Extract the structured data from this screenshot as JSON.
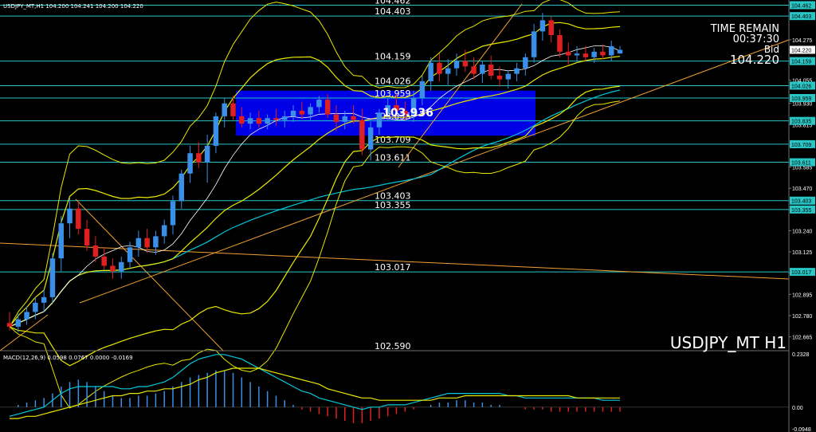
{
  "header": {
    "symbol_info": "USDJPY_MT,H1  104.200 104.241 104.200 104.220"
  },
  "time_remain": {
    "label": "TIME REMAIN",
    "value": "00:37:30",
    "bid_label": "Bid",
    "bid_value": "104.220"
  },
  "watermark": "USDJPY_MT H1",
  "macd": {
    "label": "MACD(12,26,9) 0.0598 0.0767 0.0000 -0.0169",
    "axis": [
      "0.2328",
      "0.00",
      "-0.0948"
    ]
  },
  "zone_label": "103.936",
  "colors": {
    "bull": "#3a8fe8",
    "bear": "#e02020",
    "band": "#e8e800",
    "ma_cyan": "#00c8d8",
    "level": "#29c6c6",
    "trend": "#f0a030",
    "zone": "#0000ff",
    "macd_signal": "#e8e800"
  },
  "chart_data": {
    "type": "candlestick",
    "y_axis_ticks": [
      "104.275",
      "104.159",
      "104.055",
      "103.930",
      "103.815",
      "103.700",
      "103.585",
      "103.470",
      "103.355",
      "103.240",
      "103.125",
      "103.010",
      "102.895",
      "102.780",
      "102.665"
    ],
    "ylim": [
      102.59,
      104.49
    ],
    "levels": [
      {
        "value": 104.462,
        "label": "104.462"
      },
      {
        "value": 104.403,
        "label": "104.403"
      },
      {
        "value": 104.159,
        "label": "104.159"
      },
      {
        "value": 104.026,
        "label": "104.026"
      },
      {
        "value": 103.959,
        "label": "103.959"
      },
      {
        "value": 103.835,
        "label": "103.835"
      },
      {
        "value": 103.709,
        "label": "103.709"
      },
      {
        "value": 103.611,
        "label": "103.611"
      },
      {
        "value": 103.403,
        "label": "103.403"
      },
      {
        "value": 103.355,
        "label": "103.355"
      },
      {
        "value": 103.017,
        "label": "103.017"
      },
      {
        "value": 102.59,
        "label": "102.590"
      }
    ],
    "axis_level_labels": [
      "104.462",
      "104.403",
      "104.220",
      "104.159",
      "104.026",
      "103.959",
      "103.835",
      "103.709",
      "103.611",
      "103.403",
      "103.355",
      "103.017"
    ],
    "zone": {
      "high": 103.959,
      "low": 103.835
    },
    "candles": [
      [
        102.74,
        102.8,
        102.7,
        102.72
      ],
      [
        102.72,
        102.79,
        102.69,
        102.76
      ],
      [
        102.76,
        102.83,
        102.73,
        102.8
      ],
      [
        102.8,
        102.88,
        102.76,
        102.85
      ],
      [
        102.85,
        102.92,
        102.8,
        102.88
      ],
      [
        102.88,
        103.12,
        102.85,
        103.09
      ],
      [
        103.09,
        103.32,
        103.02,
        103.28
      ],
      [
        103.28,
        103.42,
        103.2,
        103.36
      ],
      [
        103.36,
        103.4,
        103.22,
        103.25
      ],
      [
        103.25,
        103.3,
        103.13,
        103.16
      ],
      [
        103.16,
        103.21,
        103.07,
        103.1
      ],
      [
        103.1,
        103.15,
        103.03,
        103.05
      ],
      [
        103.05,
        103.09,
        102.98,
        103.02
      ],
      [
        103.02,
        103.1,
        102.98,
        103.07
      ],
      [
        103.07,
        103.18,
        103.04,
        103.15
      ],
      [
        103.15,
        103.24,
        103.1,
        103.2
      ],
      [
        103.2,
        103.25,
        103.12,
        103.15
      ],
      [
        103.15,
        103.24,
        103.11,
        103.21
      ],
      [
        103.21,
        103.3,
        103.17,
        103.27
      ],
      [
        103.27,
        103.43,
        103.22,
        103.4
      ],
      [
        103.4,
        103.57,
        103.36,
        103.55
      ],
      [
        103.55,
        103.7,
        103.5,
        103.66
      ],
      [
        103.66,
        103.72,
        103.58,
        103.61
      ],
      [
        103.61,
        103.76,
        103.5,
        103.7
      ],
      [
        103.7,
        103.88,
        103.66,
        103.86
      ],
      [
        103.86,
        103.96,
        103.8,
        103.93
      ],
      [
        103.93,
        103.97,
        103.84,
        103.86
      ],
      [
        103.86,
        103.91,
        103.8,
        103.82
      ],
      [
        103.82,
        103.88,
        103.79,
        103.85
      ],
      [
        103.85,
        103.89,
        103.8,
        103.82
      ],
      [
        103.82,
        103.87,
        103.79,
        103.85
      ],
      [
        103.85,
        103.9,
        103.81,
        103.84
      ],
      [
        103.84,
        103.89,
        103.8,
        103.86
      ],
      [
        103.86,
        103.92,
        103.83,
        103.89
      ],
      [
        103.89,
        103.94,
        103.85,
        103.87
      ],
      [
        103.87,
        103.93,
        103.84,
        103.91
      ],
      [
        103.91,
        103.97,
        103.88,
        103.95
      ],
      [
        103.95,
        103.98,
        103.85,
        103.87
      ],
      [
        103.87,
        103.92,
        103.78,
        103.83
      ],
      [
        103.83,
        103.89,
        103.79,
        103.86
      ],
      [
        103.86,
        103.92,
        103.82,
        103.84
      ],
      [
        103.84,
        103.9,
        103.65,
        103.68
      ],
      [
        103.68,
        103.83,
        103.62,
        103.8
      ],
      [
        103.8,
        103.9,
        103.76,
        103.88
      ],
      [
        103.88,
        103.96,
        103.84,
        103.92
      ],
      [
        103.92,
        103.98,
        103.86,
        103.89
      ],
      [
        103.89,
        103.94,
        103.84,
        103.87
      ],
      [
        103.87,
        104.0,
        103.83,
        103.96
      ],
      [
        103.96,
        104.08,
        103.92,
        104.05
      ],
      [
        104.05,
        104.18,
        104.0,
        104.15
      ],
      [
        104.15,
        104.2,
        104.05,
        104.09
      ],
      [
        104.09,
        104.17,
        104.03,
        104.12
      ],
      [
        104.12,
        104.2,
        104.08,
        104.16
      ],
      [
        104.16,
        104.22,
        104.1,
        104.13
      ],
      [
        104.13,
        104.18,
        104.06,
        104.09
      ],
      [
        104.09,
        104.16,
        104.04,
        104.14
      ],
      [
        104.14,
        104.19,
        104.06,
        104.08
      ],
      [
        104.08,
        104.13,
        104.02,
        104.06
      ],
      [
        104.06,
        104.11,
        104.01,
        104.09
      ],
      [
        104.09,
        104.15,
        104.05,
        104.12
      ],
      [
        104.12,
        104.2,
        104.08,
        104.18
      ],
      [
        104.18,
        104.36,
        104.15,
        104.32
      ],
      [
        104.32,
        104.42,
        104.27,
        104.38
      ],
      [
        104.38,
        104.4,
        104.26,
        104.3
      ],
      [
        104.3,
        104.33,
        104.18,
        104.21
      ],
      [
        104.21,
        104.26,
        104.14,
        104.19
      ],
      [
        104.19,
        104.24,
        104.15,
        104.2
      ],
      [
        104.2,
        104.24,
        104.16,
        104.18
      ],
      [
        104.18,
        104.23,
        104.15,
        104.21
      ],
      [
        104.21,
        104.25,
        104.17,
        104.19
      ],
      [
        104.19,
        104.27,
        104.16,
        104.24
      ],
      [
        104.2,
        104.24,
        104.2,
        104.22
      ]
    ],
    "macd_hist": [
      0.0,
      0.01,
      0.02,
      0.03,
      0.04,
      0.06,
      0.09,
      0.11,
      0.12,
      0.11,
      0.09,
      0.07,
      0.05,
      0.04,
      0.04,
      0.05,
      0.05,
      0.06,
      0.07,
      0.09,
      0.11,
      0.13,
      0.14,
      0.15,
      0.16,
      0.16,
      0.15,
      0.13,
      0.11,
      0.09,
      0.07,
      0.05,
      0.03,
      0.01,
      -0.01,
      -0.02,
      -0.03,
      -0.04,
      -0.05,
      -0.06,
      -0.07,
      -0.07,
      -0.06,
      -0.05,
      -0.04,
      -0.03,
      -0.02,
      -0.01,
      0.0,
      0.01,
      0.02,
      0.02,
      0.03,
      0.03,
      0.02,
      0.02,
      0.01,
      0.01,
      0.0,
      0.0,
      -0.01,
      -0.01,
      -0.01,
      -0.02,
      -0.02,
      -0.02,
      -0.02,
      -0.02,
      -0.02,
      -0.02,
      -0.02,
      -0.02
    ],
    "macd_line": [
      -0.04,
      -0.03,
      -0.02,
      -0.01,
      0.0,
      0.03,
      0.06,
      0.08,
      0.09,
      0.09,
      0.09,
      0.09,
      0.09,
      0.08,
      0.08,
      0.09,
      0.09,
      0.1,
      0.11,
      0.13,
      0.16,
      0.19,
      0.21,
      0.22,
      0.23,
      0.23,
      0.22,
      0.21,
      0.19,
      0.17,
      0.15,
      0.13,
      0.11,
      0.09,
      0.07,
      0.06,
      0.04,
      0.03,
      0.02,
      0.01,
      0.0,
      -0.01,
      0.0,
      0.0,
      0.01,
      0.01,
      0.01,
      0.02,
      0.03,
      0.04,
      0.05,
      0.06,
      0.06,
      0.06,
      0.06,
      0.06,
      0.06,
      0.06,
      0.05,
      0.05,
      0.04,
      0.04,
      0.04,
      0.04,
      0.04,
      0.04,
      0.04,
      0.04,
      0.04,
      0.03,
      0.03,
      0.03
    ],
    "macd_signal": [
      -0.05,
      -0.05,
      -0.04,
      -0.04,
      -0.03,
      -0.02,
      -0.01,
      0.0,
      0.01,
      0.02,
      0.03,
      0.04,
      0.05,
      0.05,
      0.06,
      0.06,
      0.07,
      0.07,
      0.08,
      0.08,
      0.09,
      0.1,
      0.12,
      0.13,
      0.15,
      0.16,
      0.17,
      0.17,
      0.17,
      0.17,
      0.16,
      0.15,
      0.14,
      0.13,
      0.12,
      0.11,
      0.1,
      0.08,
      0.07,
      0.06,
      0.05,
      0.04,
      0.04,
      0.03,
      0.03,
      0.03,
      0.03,
      0.03,
      0.03,
      0.03,
      0.04,
      0.04,
      0.04,
      0.05,
      0.05,
      0.05,
      0.05,
      0.05,
      0.05,
      0.05,
      0.05,
      0.05,
      0.05,
      0.05,
      0.05,
      0.05,
      0.04,
      0.04,
      0.04,
      0.04,
      0.04,
      0.04
    ],
    "macd_ylim": [
      -0.0948,
      0.2328
    ]
  }
}
